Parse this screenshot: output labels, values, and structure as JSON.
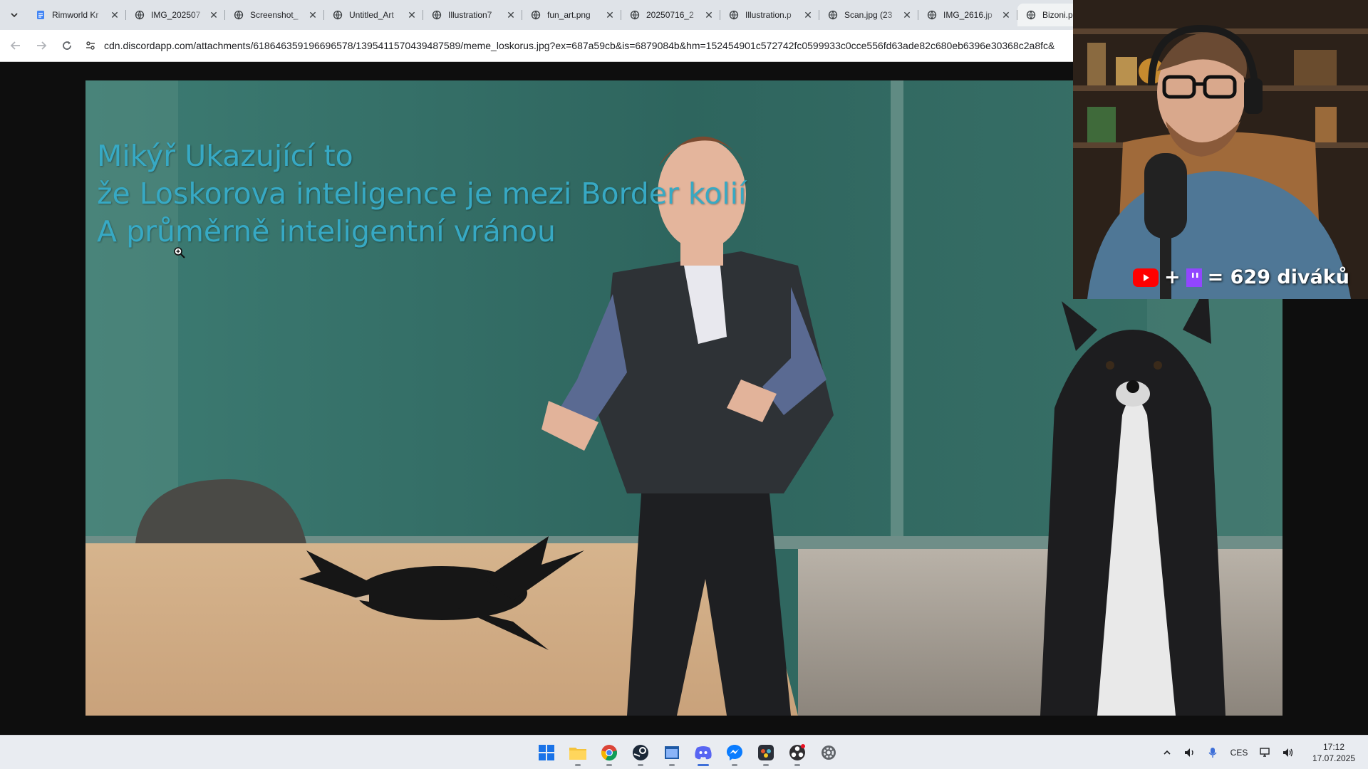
{
  "browser": {
    "tabs": [
      {
        "title": "Rimworld Kr",
        "favicon": "document-icon",
        "active": false
      },
      {
        "title": "IMG_202507",
        "favicon": "globe-icon",
        "active": false
      },
      {
        "title": "Screenshot_",
        "favicon": "globe-icon",
        "active": false
      },
      {
        "title": "Untitled_Art",
        "favicon": "globe-icon",
        "active": false
      },
      {
        "title": "Illustration7",
        "favicon": "globe-icon",
        "active": false
      },
      {
        "title": "fun_art.png",
        "favicon": "globe-icon",
        "active": false
      },
      {
        "title": "20250716_2",
        "favicon": "globe-icon",
        "active": false
      },
      {
        "title": "Illustration.p",
        "favicon": "globe-icon",
        "active": false
      },
      {
        "title": "Scan.jpg (23",
        "favicon": "globe-icon",
        "active": false
      },
      {
        "title": "IMG_2616.jp",
        "favicon": "globe-icon",
        "active": false
      },
      {
        "title": "Bizoni.pn",
        "favicon": "globe-icon",
        "active": true
      }
    ],
    "url": "cdn.discordapp.com/attachments/618646359196696578/1395411570439487589/meme_loskorus.jpg?ex=687a59cb&is=6879084b&hm=152454901c572742fc0599933c0cce556fd63ade82c680eb6396e30368c2a8fc&"
  },
  "meme": {
    "caption_lines": [
      "Mikýř Ukazující to",
      "že Loskorova inteligence je mezi Border kolií",
      "A průměrně inteligentní vránou"
    ],
    "caption_color": "#37a9c4"
  },
  "webcam": {
    "viewer_label": "= 629 diváků",
    "plus": "+"
  },
  "taskbar": {
    "apps": [
      {
        "name": "windows-start-icon",
        "active": false
      },
      {
        "name": "file-explorer-icon",
        "active": false
      },
      {
        "name": "chrome-icon",
        "active": false
      },
      {
        "name": "steam-icon",
        "active": false
      },
      {
        "name": "app-window-icon",
        "active": false
      },
      {
        "name": "discord-icon",
        "active": true
      },
      {
        "name": "messenger-icon",
        "active": false
      },
      {
        "name": "davinci-resolve-icon",
        "active": false
      },
      {
        "name": "obs-icon",
        "active": false
      },
      {
        "name": "settings-icon",
        "active": false
      }
    ],
    "language": "CES",
    "time": "17:12",
    "date": "17.07.2025"
  }
}
